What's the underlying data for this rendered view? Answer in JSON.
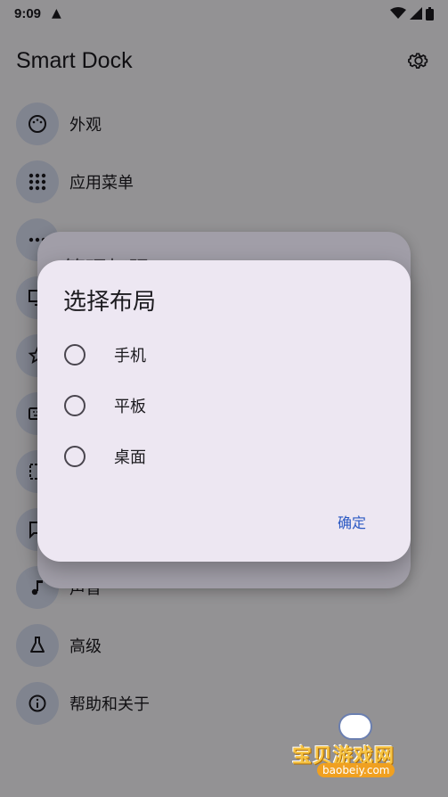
{
  "status_bar": {
    "time": "9:09"
  },
  "app_bar": {
    "title": "Smart Dock"
  },
  "menu": [
    {
      "label": "外观",
      "icon": "palette-icon"
    },
    {
      "label": "应用菜单",
      "icon": "apps-grid-icon"
    },
    {
      "label": "",
      "icon": "more-horiz-icon"
    },
    {
      "label": "",
      "icon": "monitor-icon"
    },
    {
      "label": "",
      "icon": "star-icon"
    },
    {
      "label": "",
      "icon": "keyboard-icon"
    },
    {
      "label": "",
      "icon": "crop-icon"
    },
    {
      "label": "",
      "icon": "message-icon"
    },
    {
      "label": "声音",
      "icon": "music-note-icon"
    },
    {
      "label": "高级",
      "icon": "flask-icon"
    },
    {
      "label": "帮助和关于",
      "icon": "info-icon"
    }
  ],
  "back_dialog": {
    "title": "管理权限"
  },
  "dialog": {
    "title": "选择布局",
    "options": [
      "手机",
      "平板",
      "桌面"
    ],
    "confirm": "确定"
  },
  "watermark": {
    "text": "宝贝游戏网",
    "url": "baobeiy.com"
  }
}
